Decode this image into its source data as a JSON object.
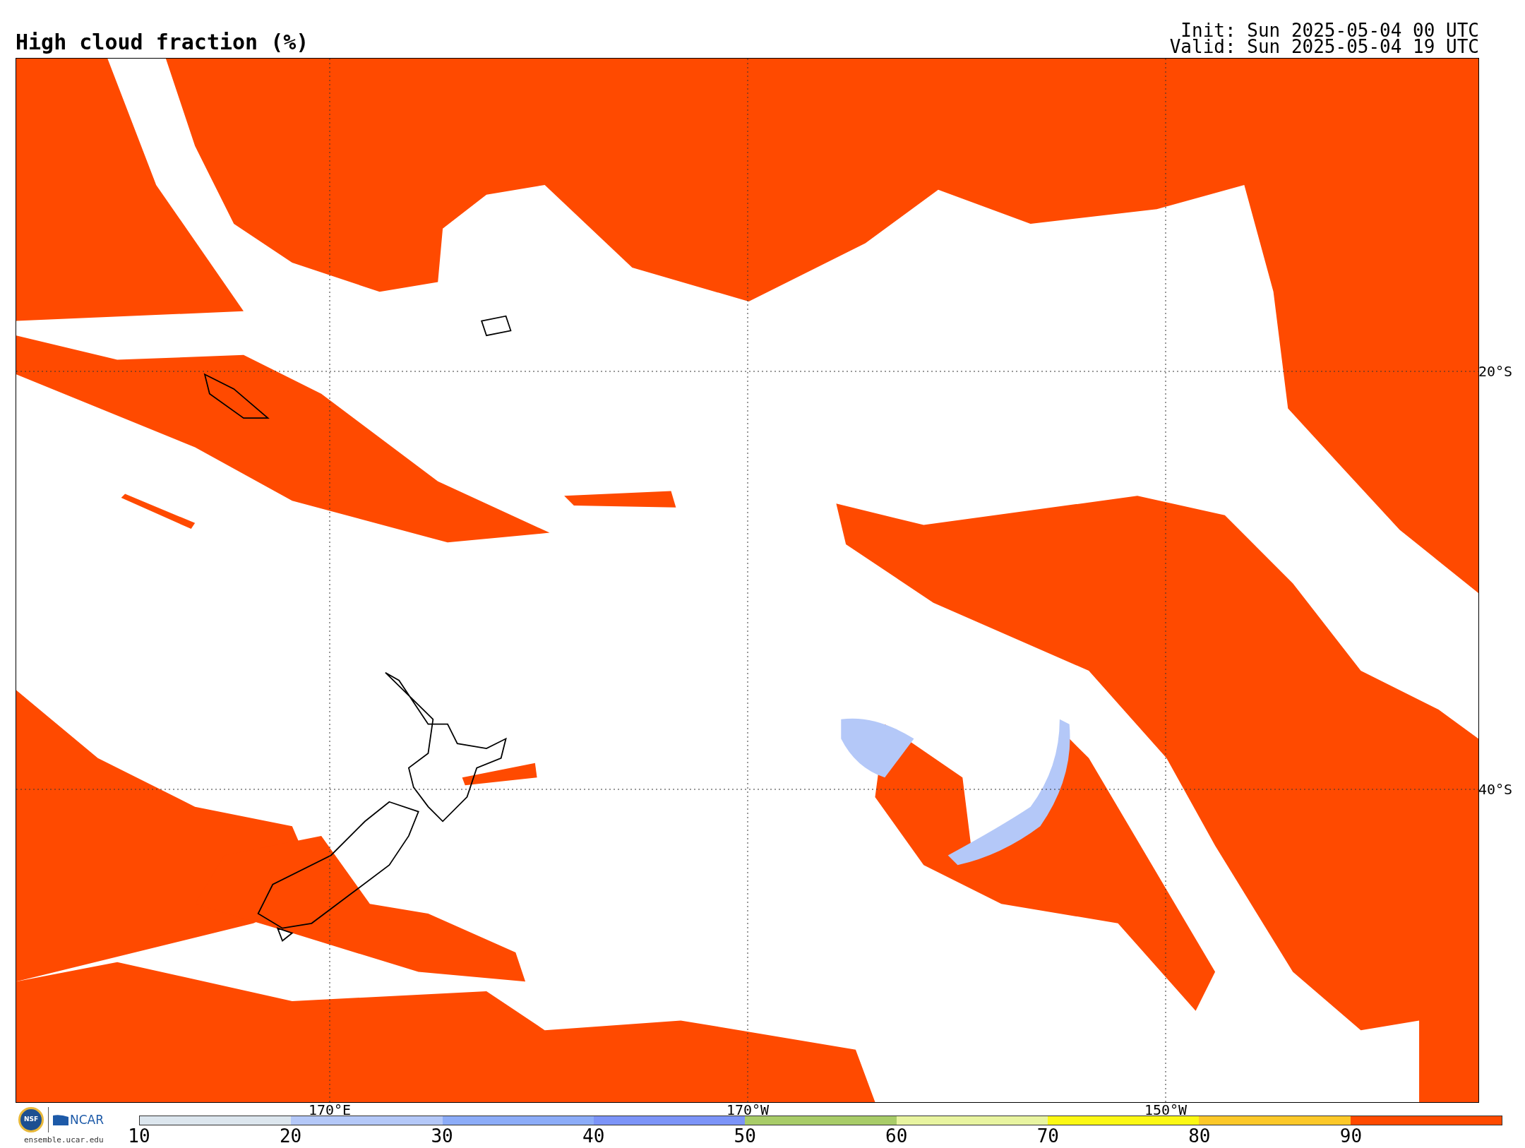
{
  "title": "High cloud fraction (%)",
  "run_info": [
    "Init: Sun 2025-05-04 00 UTC",
    "Valid: Sun 2025-05-04 19 UTC"
  ],
  "map": {
    "longitude_labels": [
      "170°E",
      "170°W",
      "150°W"
    ],
    "latitude_labels": [
      "20°S",
      "40°S"
    ]
  },
  "colorbar": {
    "segments": [
      {
        "color": "#dce6ee"
      },
      {
        "color": "#b4c8f8"
      },
      {
        "color": "#8cacf8"
      },
      {
        "color": "#7c94f8"
      },
      {
        "color": "#a8cc68"
      },
      {
        "color": "#e8f4a0"
      },
      {
        "color": "#fcf814"
      },
      {
        "color": "#fcc828"
      },
      {
        "color": "#ff4a00"
      }
    ],
    "tick_labels": [
      "10",
      "20",
      "30",
      "40",
      "50",
      "60",
      "70",
      "80",
      "90"
    ]
  },
  "logo": {
    "nsf": "NSF",
    "ncar": "NCAR",
    "url": "ensemble.ucar.edu"
  }
}
